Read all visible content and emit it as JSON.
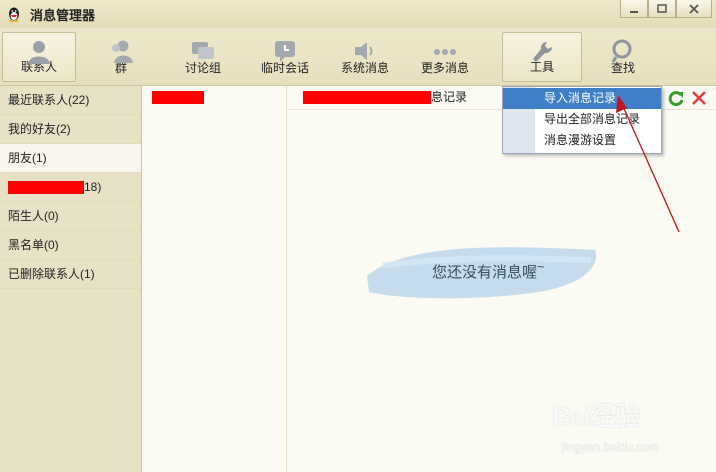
{
  "window": {
    "title": "消息管理器",
    "icon": "qq-penguin-icon",
    "controls": [
      "minimize",
      "maximize",
      "close"
    ]
  },
  "toolbar": {
    "items": [
      {
        "label": "联系人",
        "icon": "person-icon",
        "selected": true
      },
      {
        "label": "群",
        "icon": "group-icon"
      },
      {
        "label": "讨论组",
        "icon": "chat-bubbles-icon"
      },
      {
        "label": "临时会话",
        "icon": "temp-chat-icon"
      },
      {
        "label": "系统消息",
        "icon": "speaker-icon"
      },
      {
        "label": "更多消息",
        "icon": "more-dots-icon"
      },
      {
        "label": "工具",
        "icon": "wrench-icon",
        "selected": true
      },
      {
        "label": "查找",
        "icon": "magnifier-icon"
      }
    ]
  },
  "sidebar": {
    "groups": [
      {
        "label": "最近联系人(22)"
      },
      {
        "label": "我的好友(2)"
      },
      {
        "label": "朋友(1)",
        "selected": true
      },
      {
        "label": "18)",
        "redacted_prefix": true
      },
      {
        "label": "陌生人(0)"
      },
      {
        "label": "黑名单(0)"
      },
      {
        "label": "已删除联系人(1)"
      }
    ]
  },
  "contact_list": {
    "rows": [
      {
        "label": "",
        "redacted": true
      }
    ]
  },
  "content": {
    "header_suffix": "息记录",
    "empty_message": "您还没有消息喔",
    "empty_tilde": "~"
  },
  "tools_menu": {
    "items": [
      {
        "label": "导入消息记录",
        "active": true
      },
      {
        "label": "导出全部消息记录"
      },
      {
        "label": "消息漫游设置"
      }
    ]
  },
  "watermark": {
    "brand": "Bai经验",
    "url": "jingyan.baidu.com"
  },
  "colors": {
    "menu_highlight": "#3f7fc8",
    "redaction": "#ff0000",
    "annotation_arrow": "#c0141e"
  }
}
